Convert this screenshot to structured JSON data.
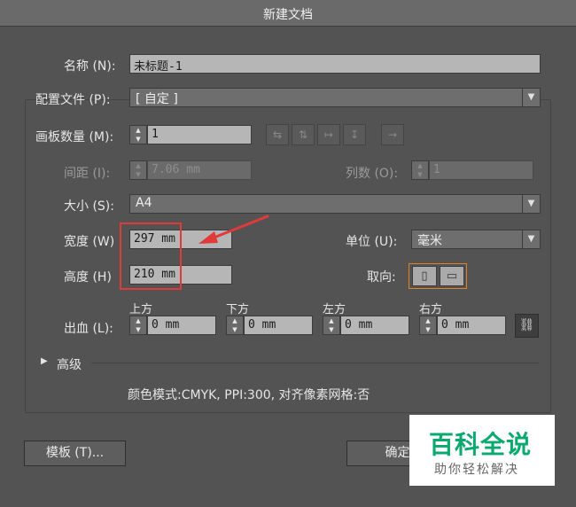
{
  "window": {
    "title": "新建文档"
  },
  "name": {
    "label": "名称 (N):",
    "value": "未标题-1"
  },
  "profile": {
    "label": "配置文件 (P):",
    "value": "[ 自定 ]"
  },
  "artboards": {
    "label": "画板数量 (M):",
    "value": "1"
  },
  "spacing": {
    "label": "间距 (I):",
    "value": "7.06 mm"
  },
  "columns": {
    "label": "列数 (O):",
    "value": "1"
  },
  "size": {
    "label": "大小 (S):",
    "value": "A4"
  },
  "width": {
    "label": "宽度 (W)",
    "value": "297 mm"
  },
  "height": {
    "label": "高度 (H)",
    "value": "210 mm"
  },
  "units": {
    "label": "单位 (U):",
    "value": "毫米"
  },
  "orientation": {
    "label": "取向:"
  },
  "bleed": {
    "label": "出血 (L):",
    "top": {
      "label": "上方",
      "value": "0 mm"
    },
    "bottom": {
      "label": "下方",
      "value": "0 mm"
    },
    "left": {
      "label": "左方",
      "value": "0 mm"
    },
    "right": {
      "label": "右方",
      "value": "0 mm"
    }
  },
  "advanced": {
    "label": "高级"
  },
  "info": "颜色模式:CMYK, PPI:300, 对齐像素网格:否",
  "buttons": {
    "templates": "模板 (T)...",
    "ok": "确定"
  },
  "watermark": {
    "title": "百科全说",
    "subtitle": "助你轻松解决"
  },
  "colors": {
    "highlight": "#e03a3a",
    "orientation_border": "#e0821d",
    "watermark_green": "#0aa96f"
  },
  "icons": {
    "spinner": "spinner-arrows-icon",
    "dropdown": "chevron-down-icon",
    "arrangement": [
      "grid-by-row-icon",
      "grid-by-column-icon",
      "arrange-by-row-icon",
      "arrange-by-column-icon",
      "right-to-left-icon"
    ],
    "orientation": [
      "portrait-icon",
      "landscape-icon"
    ],
    "link": "link-chain-icon"
  }
}
